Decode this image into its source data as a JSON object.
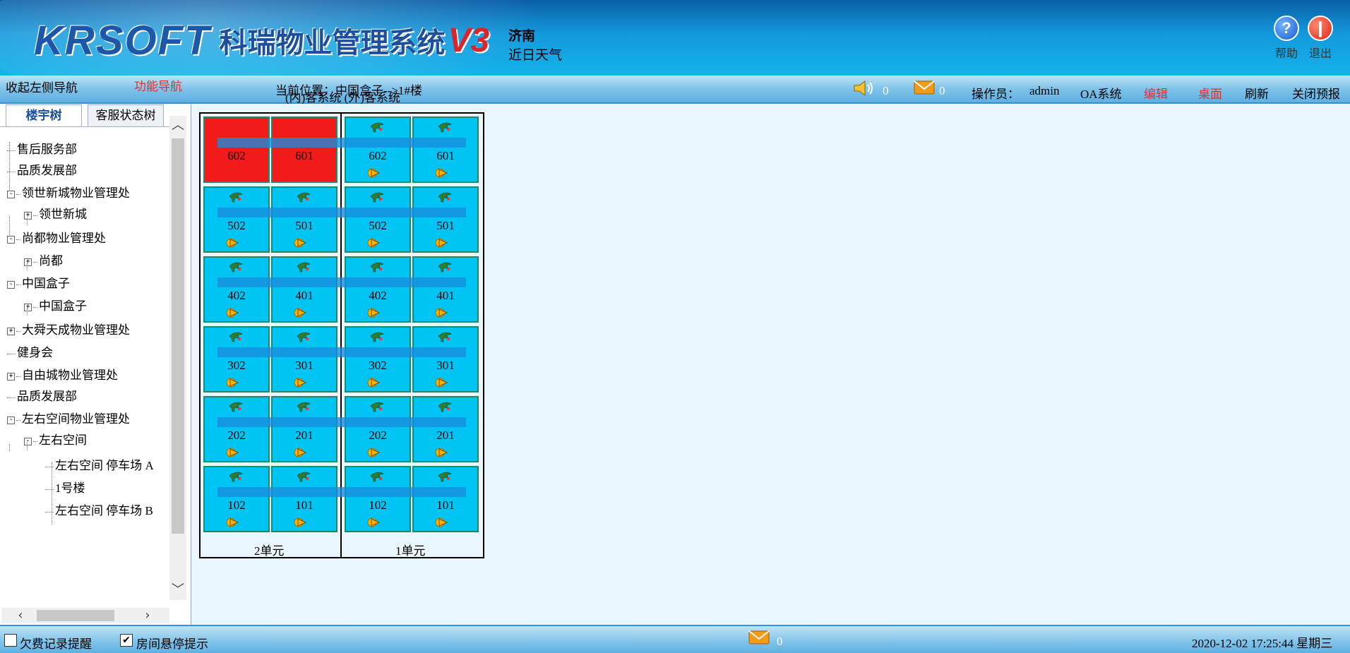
{
  "header": {
    "logo_brand": "KRSOFT",
    "logo_name": "科瑞物业管理系统",
    "logo_version": "V3",
    "weather_city": "济南",
    "weather_label": "近日天气",
    "help_label": "帮助",
    "exit_label": "退出"
  },
  "toolbar": {
    "collapse_nav": "收起左侧导航",
    "function_nav": "功能导航",
    "location_label": "当前位置：中国盒子-->1#楼",
    "location_sub": "(内)客系统 (外)客系统",
    "sound_count": "0",
    "mail_count": "0",
    "operator_label": "操作员：",
    "operator_name": "admin",
    "oa_system": "OA系统",
    "edit": "编辑",
    "desktop": "桌面",
    "refresh": "刷新",
    "close_alert": "关闭预报"
  },
  "left_panel": {
    "tabs": [
      "楼宇树",
      "客服状态树"
    ],
    "tree": [
      {
        "label": "售后服务部",
        "toggle": ""
      },
      {
        "label": "品质发展部",
        "toggle": ""
      },
      {
        "label": "领世新城物业管理处",
        "toggle": "-"
      },
      {
        "label": "领世新城",
        "toggle": "+"
      },
      {
        "label": "尚都物业管理处",
        "toggle": "-"
      },
      {
        "label": "尚都",
        "toggle": "+"
      },
      {
        "label": "中国盒子",
        "toggle": "-"
      },
      {
        "label": "中国盒子",
        "toggle": "+"
      },
      {
        "label": "大舜天成物业管理处",
        "toggle": "+"
      },
      {
        "label": "健身会",
        "toggle": ""
      },
      {
        "label": "自由城物业管理处",
        "toggle": "+"
      },
      {
        "label": "品质发展部",
        "toggle": ""
      },
      {
        "label": "左右空间物业管理处",
        "toggle": "-"
      },
      {
        "label": "左右空间",
        "toggle": "-"
      },
      {
        "label": "左右空间 停车场 A",
        "toggle": ""
      },
      {
        "label": "1号楼",
        "toggle": ""
      },
      {
        "label": "左右空间 停车场 B",
        "toggle": ""
      }
    ]
  },
  "board": {
    "units": [
      {
        "label": "2单元",
        "rows": [
          [
            "602",
            "601"
          ],
          [
            "502",
            "501"
          ],
          [
            "402",
            "401"
          ],
          [
            "302",
            "301"
          ],
          [
            "202",
            "201"
          ],
          [
            "102",
            "101"
          ]
        ]
      },
      {
        "label": "1单元",
        "rows": [
          [
            "602",
            "601"
          ],
          [
            "502",
            "501"
          ],
          [
            "402",
            "401"
          ],
          [
            "302",
            "301"
          ],
          [
            "202",
            "201"
          ],
          [
            "102",
            "101"
          ]
        ]
      }
    ],
    "occupied_color": "#f21a1a",
    "vacant_color": "#00c5f4"
  },
  "footer": {
    "arrears_reminder": "欠费记录提醒",
    "room_hover_tip": "房间悬停提示",
    "mail_count": "0",
    "datetime": "2020-12-02 17:25:44 星期三"
  }
}
